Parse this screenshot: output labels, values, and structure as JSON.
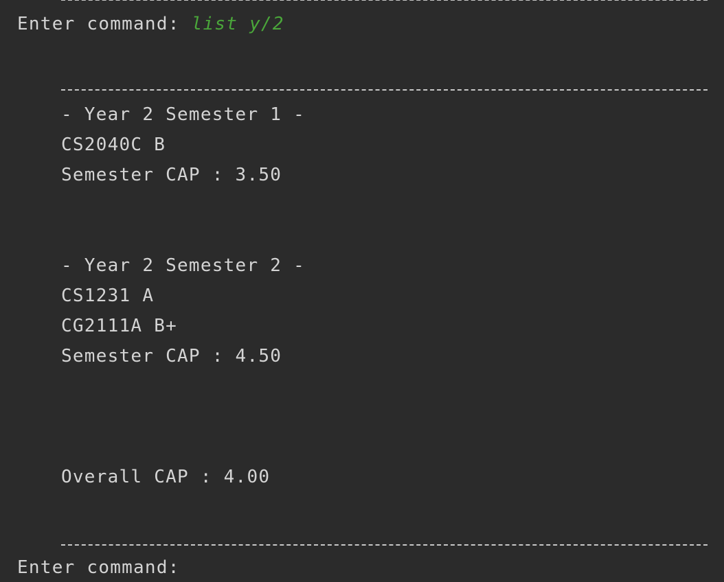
{
  "console": {
    "prompt_label": "Enter command:",
    "entered_command": "list y/2",
    "semesters": [
      {
        "heading": "- Year 2 Semester 1 -",
        "modules": [
          "CS2040C B"
        ],
        "cap_line": "Semester CAP : 3.50"
      },
      {
        "heading": "- Year 2 Semester 2 -",
        "modules": [
          "CS1231 A",
          "CG2111A B+"
        ],
        "cap_line": "Semester CAP : 4.50"
      }
    ],
    "overall_cap_line": "Overall CAP : 4.00",
    "next_prompt_label": "Enter command:"
  },
  "colors": {
    "background": "#2b2b2b",
    "text": "#d4d4d4",
    "user_input": "#4aa63a"
  }
}
